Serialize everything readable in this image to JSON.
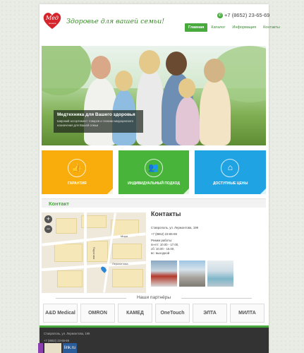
{
  "header": {
    "slogan": "Здоровье для вашей семьи!",
    "phone": "+7 (8652) 23-65-69",
    "logo_text": "Мед",
    "logo_subtext": "техника"
  },
  "nav": {
    "items": [
      {
        "label": "Главная",
        "active": true
      },
      {
        "label": "Каталог",
        "active": false
      },
      {
        "label": "Информация",
        "active": false
      },
      {
        "label": "Контакты",
        "active": false
      }
    ]
  },
  "hero": {
    "title": "Медтехника для Вашего здоровья",
    "text": "Широкий ассортимент товаров и техники медицинского назначения для Вашей семьи"
  },
  "tiles": [
    {
      "label": "Гарантия",
      "icon": "thumbs-up-icon",
      "glyph": "👍",
      "color": "#f8ad0d"
    },
    {
      "label": "Индивидуальный подход",
      "icon": "people-icon",
      "glyph": "👥",
      "color": "#48b43a"
    },
    {
      "label": "Доступные цены",
      "icon": "house-icon",
      "glyph": "⌂",
      "color": "#1fa3e3"
    }
  ],
  "contact_section": {
    "label": "Контакт",
    "title": "Контакты",
    "address": "Ставрополь, ул. Лермонтова, 199",
    "phone": "+7 (8652) 23-65-69",
    "hours_title": "Режим работы:",
    "hours_weekdays": "пн-пт: 10.00 - 17.00,",
    "hours_sat": "сб: 10.00 - 15.00,",
    "hours_sun": "вс: выходной"
  },
  "map": {
    "zoom_in": "+",
    "zoom_out": "−",
    "streets": [
      "Мира",
      "Лермонтова",
      "Пирогова"
    ]
  },
  "partners": {
    "title": "Наши партнёры",
    "items": [
      "A&D Medical",
      "OMRON",
      "КАМЕД",
      "OneTouch",
      "ЭЛТА",
      "МИЛТА"
    ]
  },
  "footer": {
    "address": "Ставрополь, ул. Лермонтова, 199",
    "phone": "+7 (8652) 23-65-69"
  },
  "counters": [
    "",
    "",
    "link.ru"
  ]
}
